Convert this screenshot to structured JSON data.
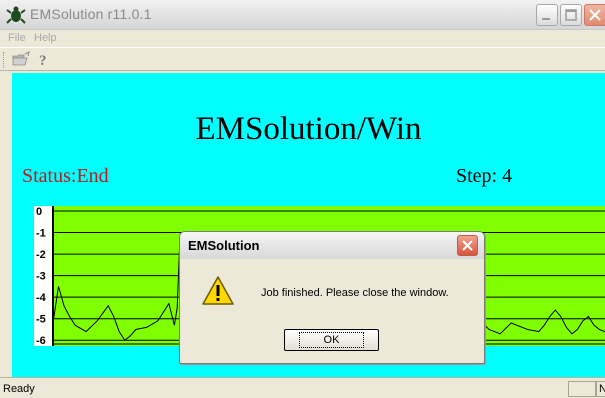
{
  "window": {
    "title": "EMSolution r11.0.1"
  },
  "menu": {
    "file_label": "File",
    "help_label": "Help"
  },
  "toolbar": {
    "open_icon": "open-folder-icon",
    "help_icon": "question-icon"
  },
  "main": {
    "heading": "EMSolution/Win",
    "status": "Status:End",
    "step": "Step: 4",
    "background_color": "#00ffff",
    "status_color": "#b32020"
  },
  "chart_data": {
    "type": "line",
    "title": "",
    "xlabel": "",
    "ylabel": "",
    "y_ticks": [
      "0",
      "-1",
      "-2",
      "-3",
      "-4",
      "-5",
      "-6"
    ],
    "ylim": [
      -6.5,
      0
    ],
    "xlim": [
      0,
      100
    ],
    "grid": true,
    "plot_background": "#80ff00",
    "line_color": "#000000",
    "series": [
      {
        "x": [
          0,
          1,
          2,
          3,
          4,
          6,
          8,
          10,
          11,
          12,
          13,
          14,
          15,
          17,
          19,
          21,
          22,
          22.5,
          23,
          24,
          25,
          26,
          27,
          28,
          29,
          30,
          31,
          32,
          33,
          34,
          35,
          36,
          77,
          79,
          81,
          83,
          84,
          86,
          88,
          89,
          90,
          91,
          92,
          93,
          94,
          95,
          96,
          97,
          98,
          99,
          100
        ],
        "y": [
          -5.2,
          -3.5,
          -4.4,
          -4.9,
          -5.3,
          -5.6,
          -5.1,
          -4.4,
          -4.9,
          -5.6,
          -6.0,
          -5.8,
          -5.5,
          -5.4,
          -5.1,
          -4.3,
          -5.3,
          -4.5,
          -1.2,
          -1.8,
          -1.5,
          -1.9,
          -1.7,
          -2.0,
          -2.1,
          -1.6,
          -1.9,
          -1.5,
          -1.8,
          -2.2,
          -2.4,
          -2.5,
          -5.0,
          -5.5,
          -5.7,
          -5.2,
          -5.3,
          -5.5,
          -5.6,
          -5.3,
          -4.9,
          -4.6,
          -4.9,
          -5.4,
          -5.7,
          -5.5,
          -5.1,
          -4.9,
          -5.3,
          -5.5,
          -5.6
        ]
      }
    ]
  },
  "dialog": {
    "title": "EMSolution",
    "message": "Job finished. Please close the window.",
    "ok_label": "OK",
    "icon": "warning-icon"
  },
  "statusbar": {
    "text": "Ready",
    "indicator": "NU"
  }
}
